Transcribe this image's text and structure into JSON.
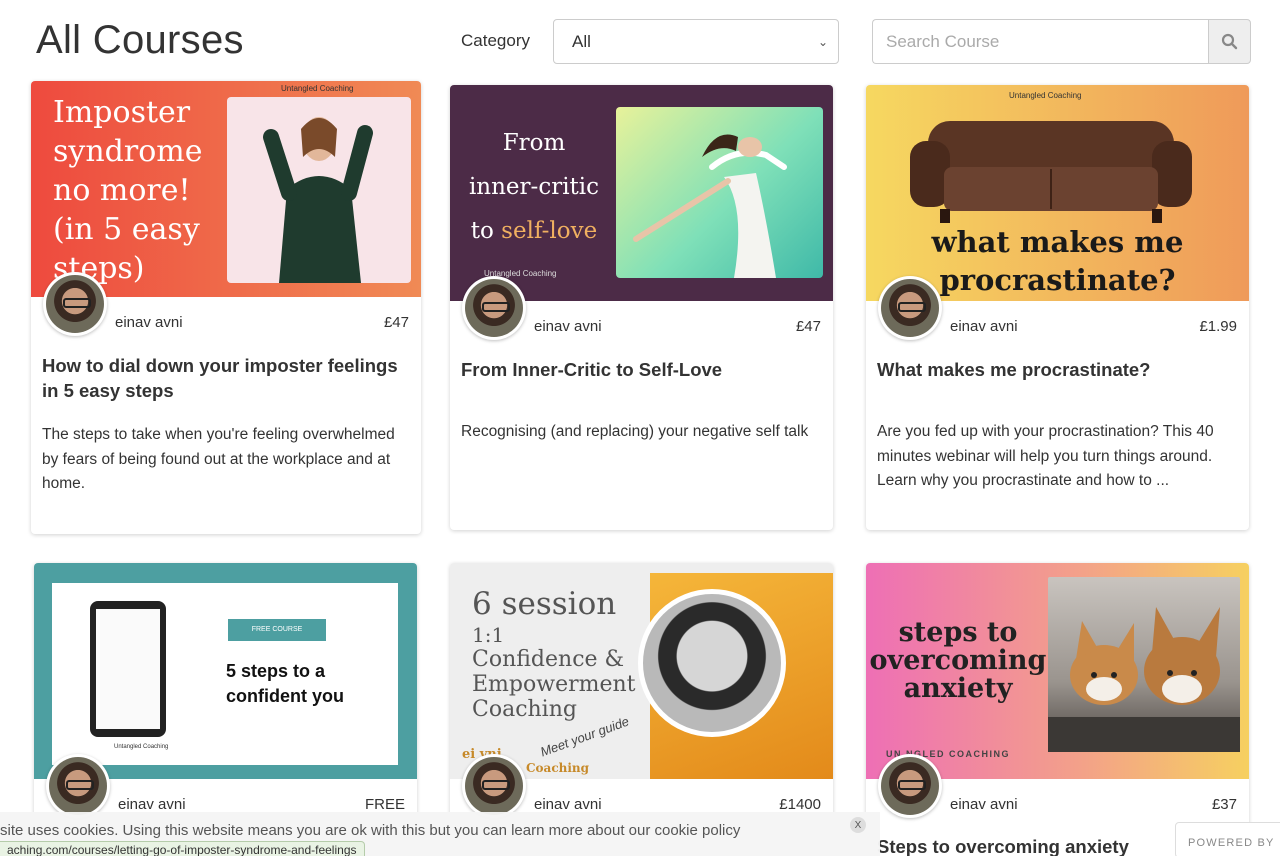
{
  "header": {
    "title": "All Courses",
    "category_label": "Category",
    "category_value": "All",
    "search_placeholder": "Search Course"
  },
  "courses": [
    {
      "image_text": [
        "Imposter",
        "syndrome",
        "no more!",
        "(in 5 easy",
        "steps)"
      ],
      "image_brand": "Untangled Coaching",
      "author": "einav avni",
      "price": "£47",
      "title": "How to dial down your imposter feelings in 5 easy steps",
      "description": "The steps to take when you're feeling overwhelmed by fears of being found out at the workplace and at home."
    },
    {
      "image_text": [
        "From",
        "inner-critic",
        "to",
        "self-love"
      ],
      "image_brand": "Untangled Coaching",
      "author": "einav avni",
      "price": "£47",
      "title": "From Inner-Critic to Self-Love",
      "description": "Recognising (and replacing) your negative self talk"
    },
    {
      "image_text": [
        "what makes me",
        "procrastinate?"
      ],
      "image_brand": "Untangled Coaching",
      "author": "einav avni",
      "price": "£1.99",
      "title": "What makes me procrastinate?",
      "description": "Are you fed up with your procrastination? This 40 minutes webinar will help you turn things around. Learn why you procrastinate and how to ..."
    },
    {
      "image_badge": "FREE COURSE",
      "image_text": [
        "5 steps to a",
        "confident you"
      ],
      "image_brand": "Untangled Coaching",
      "author": "einav avni",
      "price": "FREE"
    },
    {
      "image_text": [
        "6 session",
        "1:1",
        "Confidence &",
        "Empowerment",
        "Coaching"
      ],
      "image_script": "Meet your guide",
      "image_footer_a": "ei   vni",
      "image_footer_b": "Coaching",
      "author": "einav avni",
      "price": "£1400"
    },
    {
      "image_text": [
        "steps to",
        "overcoming",
        "anxiety"
      ],
      "image_brand": "UN   NGLED COACHING",
      "author": "einav avni",
      "price": "£37",
      "title": "Steps to overcoming anxiety"
    }
  ],
  "footer": {
    "cookie_text": "site uses cookies. Using this website means you are ok with this but you can learn more about our cookie policy",
    "cookie_close": "X",
    "status_url": "aching.com/courses/letting-go-of-imposter-syndrome-and-feelings",
    "powered_by": "POWERED BY"
  },
  "colors": {
    "text": "#333333",
    "card1_grad": [
      "#ee4f3f",
      "#f29a5a"
    ],
    "card2_bg": "#4a2a45",
    "card3_grad": [
      "#f6d860",
      "#ef9c5c"
    ],
    "card4_bg": "#4d9ea0",
    "card6_grad": [
      "#ee6fb5",
      "#f6d060"
    ]
  }
}
